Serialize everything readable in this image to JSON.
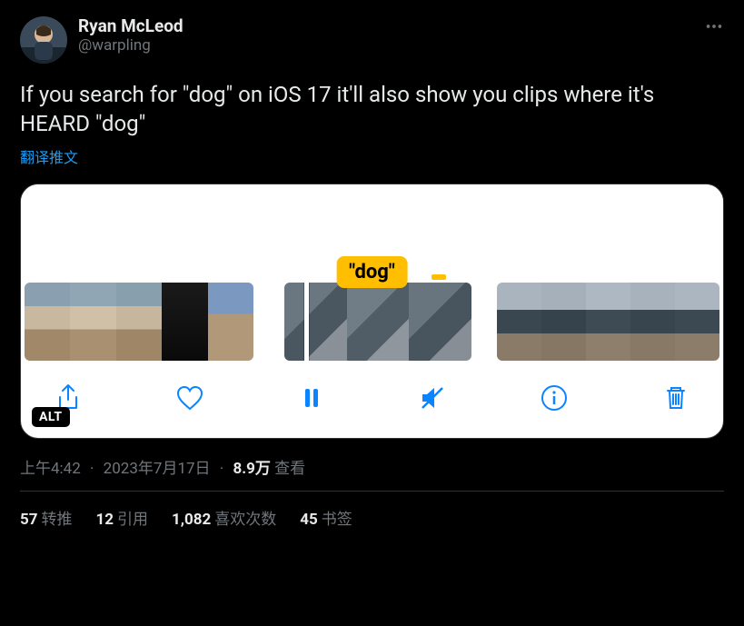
{
  "header": {
    "display_name": "Ryan McLeod",
    "handle": "@warpling"
  },
  "body": {
    "text": "If you search for \"dog\" on iOS 17 it'll also show you clips where it's HEARD \"dog\"",
    "translate": "翻译推文"
  },
  "media": {
    "dog_label": "\"dog\"",
    "alt_badge": "ALT"
  },
  "meta": {
    "time": "上午4:42",
    "date": "2023年7月17日",
    "views_num": "8.9万",
    "views_label": "查看"
  },
  "stats": {
    "retweets_num": "57",
    "retweets_label": "转推",
    "quotes_num": "12",
    "quotes_label": "引用",
    "likes_num": "1,082",
    "likes_label": "喜欢次数",
    "bookmarks_num": "45",
    "bookmarks_label": "书签"
  }
}
